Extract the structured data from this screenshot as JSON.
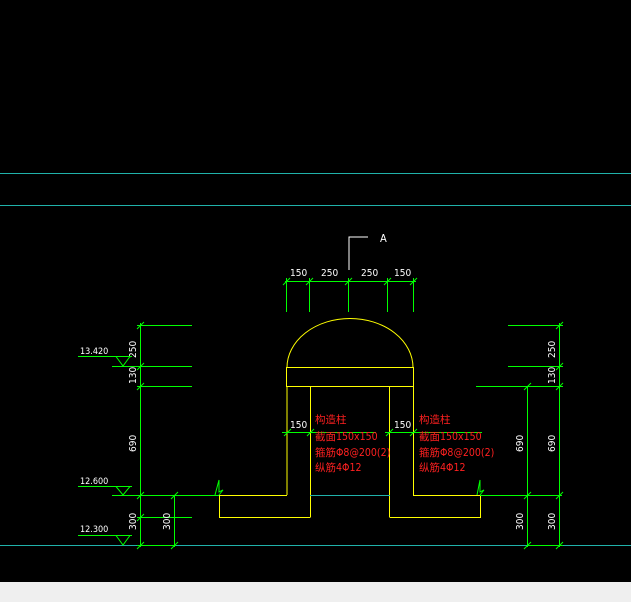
{
  "colors": {
    "background": "#000000",
    "axis_line": "#20b2aa",
    "dimension": "#00ff00",
    "outline": "#ffff00",
    "text_white": "#ffffff",
    "text_red": "#ff2020",
    "marker": "#00ffff"
  },
  "section_mark": {
    "label": "A"
  },
  "top_dims": [
    "150",
    "250",
    "250",
    "150"
  ],
  "levels": {
    "top": "13.420",
    "mid": "12.600",
    "bottom": "12.300"
  },
  "left_dims": {
    "d1": "250",
    "d2": "130",
    "d3": "690",
    "d4": "300",
    "d5": "300"
  },
  "right_dims": {
    "d1": "250",
    "d2": "130",
    "d3": "690",
    "d4": "300",
    "d5": "300"
  },
  "left_column_note": {
    "offset_dim": "150",
    "line1": "构造柱",
    "line2": "截面150x150",
    "line3": "箍筋Φ8@200(2)",
    "line4": "纵筋4Φ12"
  },
  "right_column_note": {
    "offset_dim": "150",
    "line1": "构造柱",
    "line2": "截面150x150",
    "line3": "箍筋Φ8@200(2)",
    "line4": "纵筋4Φ12"
  }
}
